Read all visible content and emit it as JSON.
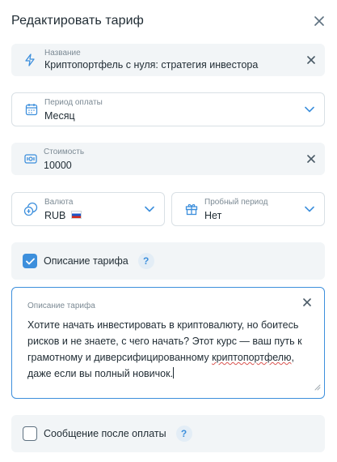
{
  "dialog": {
    "title": "Редактировать тариф"
  },
  "fields": {
    "name": {
      "label": "Название",
      "value": "Криптопортфель с нуля: стратегия инвестора"
    },
    "period": {
      "label": "Период оплаты",
      "value": "Месяц"
    },
    "price": {
      "label": "Стоимость",
      "value": "10000"
    },
    "currency": {
      "label": "Валюта",
      "value": "RUB",
      "flag": "🇷🇺"
    },
    "trial": {
      "label": "Пробный период",
      "value": "Нет"
    }
  },
  "description_toggle": {
    "label": "Описание тарифа",
    "checked": true,
    "help": "?"
  },
  "description": {
    "label": "Описание тарифа",
    "text_before": "Хотите начать инвестировать в криптовалюту, но боитесь рисков и не знаете, с чего начать? Этот курс — ваш путь к грамотному и диверсифицированному ",
    "text_misspelled": "криптопортфелю",
    "text_after": ", даже если вы полный новичок."
  },
  "after_payment_toggle": {
    "label": "Сообщение после оплаты",
    "checked": false,
    "help": "?"
  },
  "colors": {
    "accent": "#3d8fdc",
    "field_bg": "#f2f5f7",
    "border": "#d9e0e5",
    "text": "#1f2b33",
    "muted": "#7c8a94"
  },
  "icons": {
    "close": "close-icon",
    "name": "lightning-icon",
    "period": "calendar-icon",
    "price": "banknote-icon",
    "currency": "coins-icon",
    "trial": "gift-icon",
    "dropdown": "chevron-down-icon",
    "clear": "clear-icon",
    "check": "check-icon",
    "help": "help-icon",
    "resize": "resize-handle-icon"
  }
}
